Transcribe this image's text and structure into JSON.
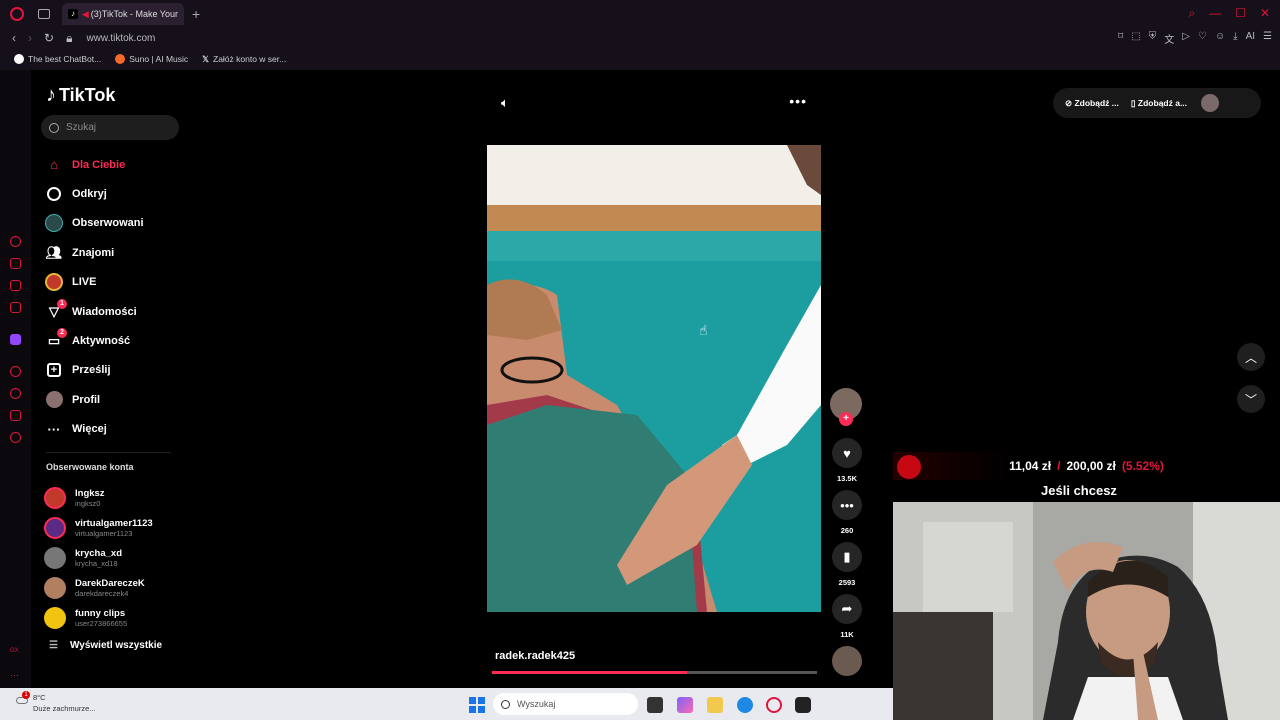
{
  "browser": {
    "tab_title": "(3)TikTok - Make Your",
    "url": "www.tiktok.com",
    "bookmarks": [
      {
        "label": "The best ChatBot...",
        "color": "#ffffff"
      },
      {
        "label": "Suno | AI Music",
        "color": "#f26b2b"
      },
      {
        "label": "Załóż konto w ser...",
        "color": "#ffffff"
      }
    ],
    "accent_color": "#e0143c"
  },
  "sidebar": {
    "logo": "TikTok",
    "search_placeholder": "Szukaj",
    "menu": [
      {
        "label": "Dla Ciebie",
        "icon": "home-icon",
        "active": true
      },
      {
        "label": "Odkryj",
        "icon": "compass-icon"
      },
      {
        "label": "Obserwowani",
        "icon": "following-avatar-icon"
      },
      {
        "label": "Znajomi",
        "icon": "friends-icon"
      },
      {
        "label": "LIVE",
        "icon": "live-icon"
      },
      {
        "label": "Wiadomości",
        "icon": "send-icon",
        "badge": "1"
      },
      {
        "label": "Aktywność",
        "icon": "message-icon",
        "badge": "2"
      },
      {
        "label": "Prześlij",
        "icon": "upload-icon"
      },
      {
        "label": "Profil",
        "icon": "profile-avatar-icon"
      },
      {
        "label": "Więcej",
        "icon": "more-dots-icon"
      }
    ],
    "following_title": "Obserwowane konta",
    "following": [
      {
        "name": "Ingksz",
        "handle": "ingksz0",
        "color": "#c0392b"
      },
      {
        "name": "virtualgamer1123",
        "handle": "virtualgamer1123",
        "color": "#5b2a86"
      },
      {
        "name": "krycha_xd",
        "handle": "krycha_xd18",
        "color": "#777777"
      },
      {
        "name": "DarekDareczeK",
        "handle": "darekdareczek4",
        "color": "#b08060"
      },
      {
        "name": "funny clips",
        "handle": "user273866655",
        "color": "#f1c40f"
      }
    ],
    "show_all": "Wyświetl wszystkie"
  },
  "video": {
    "author": "radek.radek425",
    "progress": 0.6,
    "likes": "13.5K",
    "comments": "260",
    "saves": "2593",
    "shares": "11K"
  },
  "top_right": {
    "get_app_1": "Zdobądź ...",
    "get_app_2": "Zdobądź a..."
  },
  "stream_overlay": {
    "current": "11,04 zł",
    "separator": "/",
    "goal": "200,00 zł",
    "percent": "(5.52%)",
    "subtitle": "Jeśli chcesz"
  },
  "taskbar": {
    "weather_temp": "8°C",
    "weather_desc": "Duże zachmurze...",
    "weather_badge": "1",
    "search_placeholder": "Wyszukaj"
  }
}
